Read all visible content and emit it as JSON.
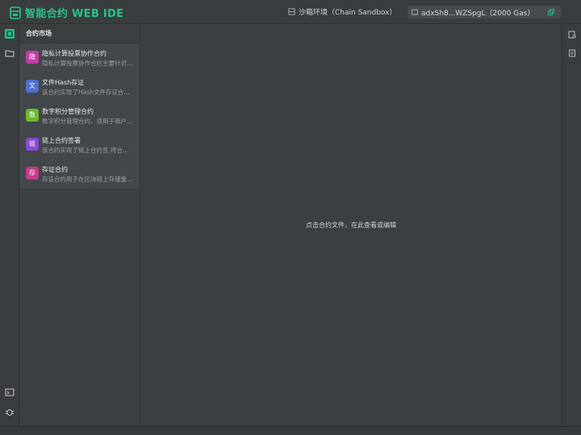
{
  "app": {
    "title": "智能合约 WEB IDE",
    "accent": "#27c28a"
  },
  "header": {
    "environment": "沙箱环境（Chain Sandbox）",
    "account": "adxSh8...WZSpgL（2000 Gas）"
  },
  "leftbar": {
    "icons": [
      "market-icon",
      "folder-icon",
      "terminal-icon",
      "bug-icon"
    ]
  },
  "rightbar": {
    "icons": [
      "doc-settings-icon",
      "doc-icon"
    ]
  },
  "sidebar": {
    "title": "合约市场",
    "items": [
      {
        "badge": "隐",
        "color": "#c03fa6",
        "title": "隐私计算投票协作合约",
        "desc": "隐私计算投票协作合约主要针对隐私计算场景"
      },
      {
        "badge": "文",
        "color": "#4f6fd1",
        "title": "文件Hash存证",
        "desc": "该合约实现了Hash文件存证合约的功能"
      },
      {
        "badge": "数",
        "color": "#6bb82f",
        "title": "数字积分管理合约",
        "desc": "数字积分管理合约，适用于商户积分管理"
      },
      {
        "badge": "链",
        "color": "#8a48d6",
        "title": "链上合约签署",
        "desc": "该合约实现了链上合约签,将合约信息上链"
      },
      {
        "badge": "存",
        "color": "#c53a8a",
        "title": "存证合约",
        "desc": "存证合约用于在区块链上存储重要数据"
      }
    ]
  },
  "editor": {
    "placeholder": "点击合约文件，在此查看或编辑"
  }
}
